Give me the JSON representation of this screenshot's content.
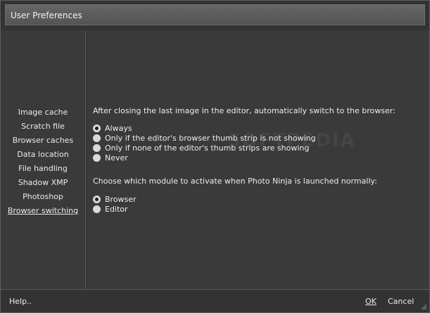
{
  "window": {
    "title": "User Preferences"
  },
  "sidebar": {
    "items": [
      {
        "label": "Image cache"
      },
      {
        "label": "Scratch file"
      },
      {
        "label": "Browser caches"
      },
      {
        "label": "Data location"
      },
      {
        "label": "File handling"
      },
      {
        "label": "Shadow XMP"
      },
      {
        "label": "Photoshop"
      },
      {
        "label": "Browser switching",
        "active": true
      }
    ]
  },
  "main": {
    "section1": {
      "question": "After closing the last image in the editor, automatically switch to the browser:",
      "options": [
        {
          "label": "Always",
          "selected": true
        },
        {
          "label": "Only if the editor's browser thumb strip is not showing",
          "selected": false
        },
        {
          "label": "Only if none of the editor's thumb strips are showing",
          "selected": false
        },
        {
          "label": "Never",
          "selected": false
        }
      ]
    },
    "section2": {
      "question": "Choose which module to activate when Photo Ninja is launched normally:",
      "options": [
        {
          "label": "Browser",
          "selected": true
        },
        {
          "label": "Editor",
          "selected": false
        }
      ]
    }
  },
  "footer": {
    "help_label": "Help..",
    "ok_label": "OK",
    "cancel_label": "Cancel"
  },
  "watermark": {
    "text": "SOFTPEDIA"
  },
  "colors": {
    "background": "#3a3a3a",
    "titlebar": "#5a5a5a",
    "text": "#ededed"
  }
}
